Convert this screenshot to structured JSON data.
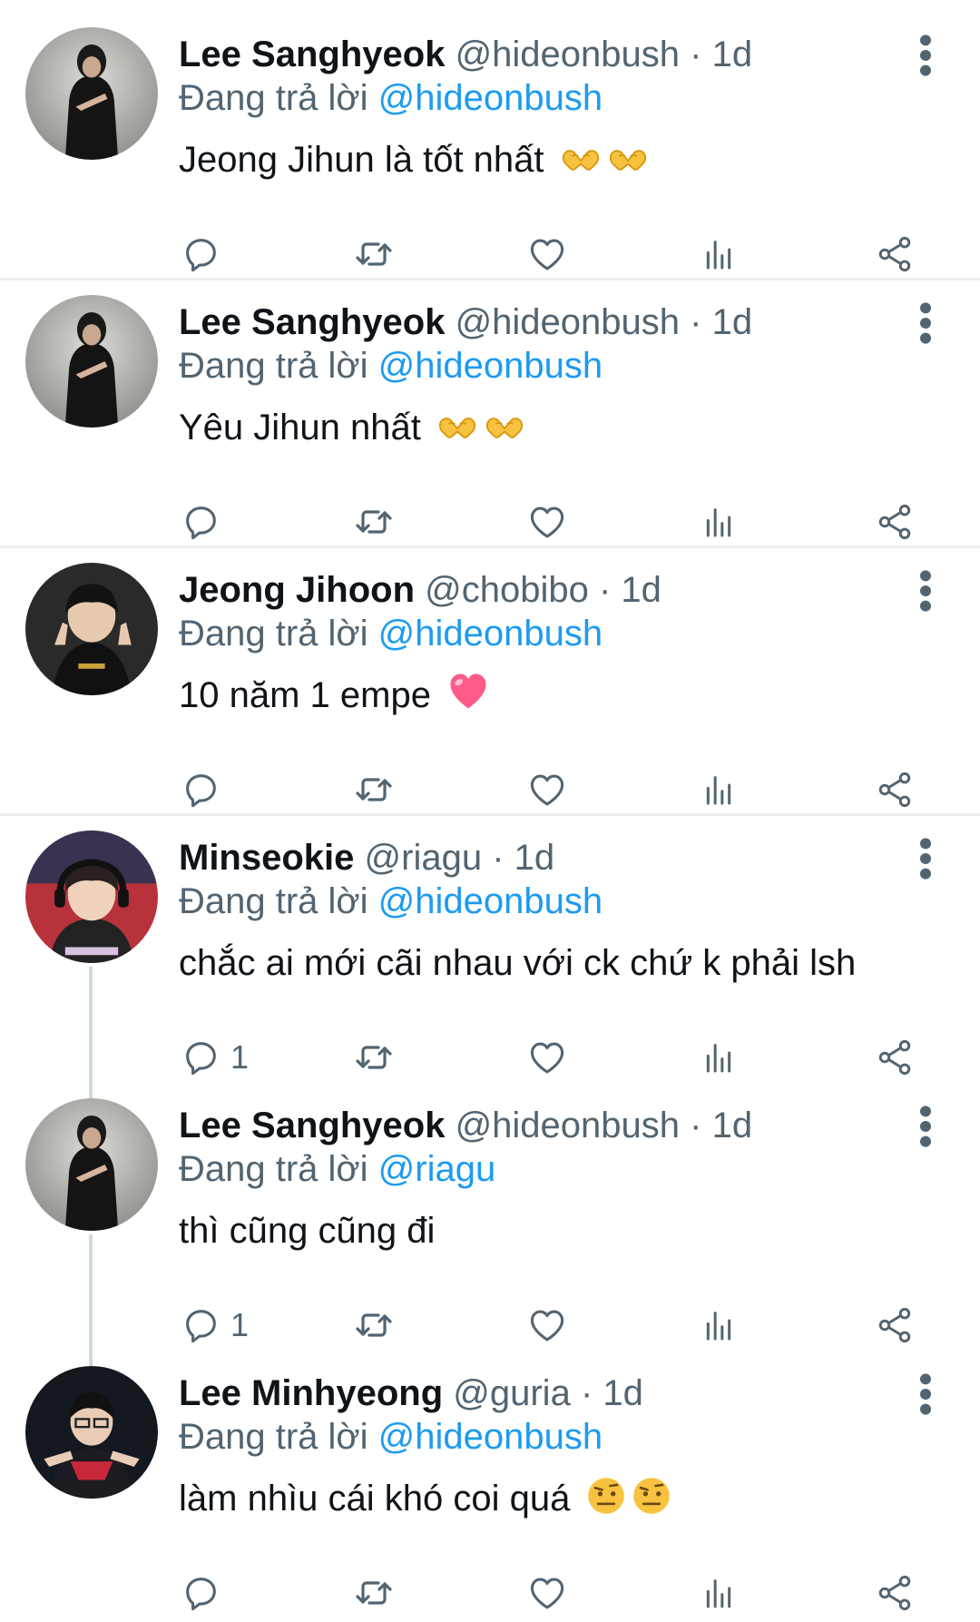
{
  "replying_label": "Đang trả lời",
  "tweets": [
    {
      "name": "Lee Sanghyeok",
      "handle": "@hideonbush",
      "separator": "·",
      "time": "1d",
      "replying_to": "@hideonbush",
      "text": "Jeong Jihun là tốt nhất",
      "emojis": [
        "heart-hands-emoji",
        "heart-hands-emoji"
      ],
      "reply_count": "",
      "avatar": "avatar-lee-sanghyeok"
    },
    {
      "name": "Lee Sanghyeok",
      "handle": "@hideonbush",
      "separator": "·",
      "time": "1d",
      "replying_to": "@hideonbush",
      "text": "Yêu Jihun nhất",
      "emojis": [
        "heart-hands-emoji",
        "heart-hands-emoji"
      ],
      "reply_count": "",
      "avatar": "avatar-lee-sanghyeok"
    },
    {
      "name": "Jeong Jihoon",
      "handle": "@chobibo",
      "separator": "·",
      "time": "1d",
      "replying_to": "@hideonbush",
      "text": "10 năm 1 empe",
      "emojis": [
        "pink-heart-emoji"
      ],
      "reply_count": "",
      "avatar": "avatar-jeong-jihoon"
    },
    {
      "name": "Minseokie",
      "handle": "@riagu",
      "separator": "·",
      "time": "1d",
      "replying_to": "@hideonbush",
      "text": "chắc ai mới cãi nhau với ck chứ k phải lsh",
      "emojis": [],
      "reply_count": "1",
      "avatar": "avatar-minseokie"
    },
    {
      "name": "Lee Sanghyeok",
      "handle": "@hideonbush",
      "separator": "·",
      "time": "1d",
      "replying_to": "@riagu",
      "text": "thì cũng cũng đi",
      "emojis": [],
      "reply_count": "1",
      "avatar": "avatar-lee-sanghyeok"
    },
    {
      "name": "Lee Minhyeong",
      "handle": "@guria",
      "separator": "·",
      "time": "1d",
      "replying_to": "@hideonbush",
      "text": "làm nhìu cái khó coi quá",
      "emojis": [
        "raised-eyebrow-emoji",
        "raised-eyebrow-emoji"
      ],
      "reply_count": "",
      "avatar": "avatar-lee-minhyeong"
    }
  ],
  "colors": {
    "accent": "#1d9bf0",
    "secondary_text": "#536471",
    "primary_text": "#0f1419",
    "divider": "#eceef0",
    "thread_line": "#cfd9de"
  }
}
